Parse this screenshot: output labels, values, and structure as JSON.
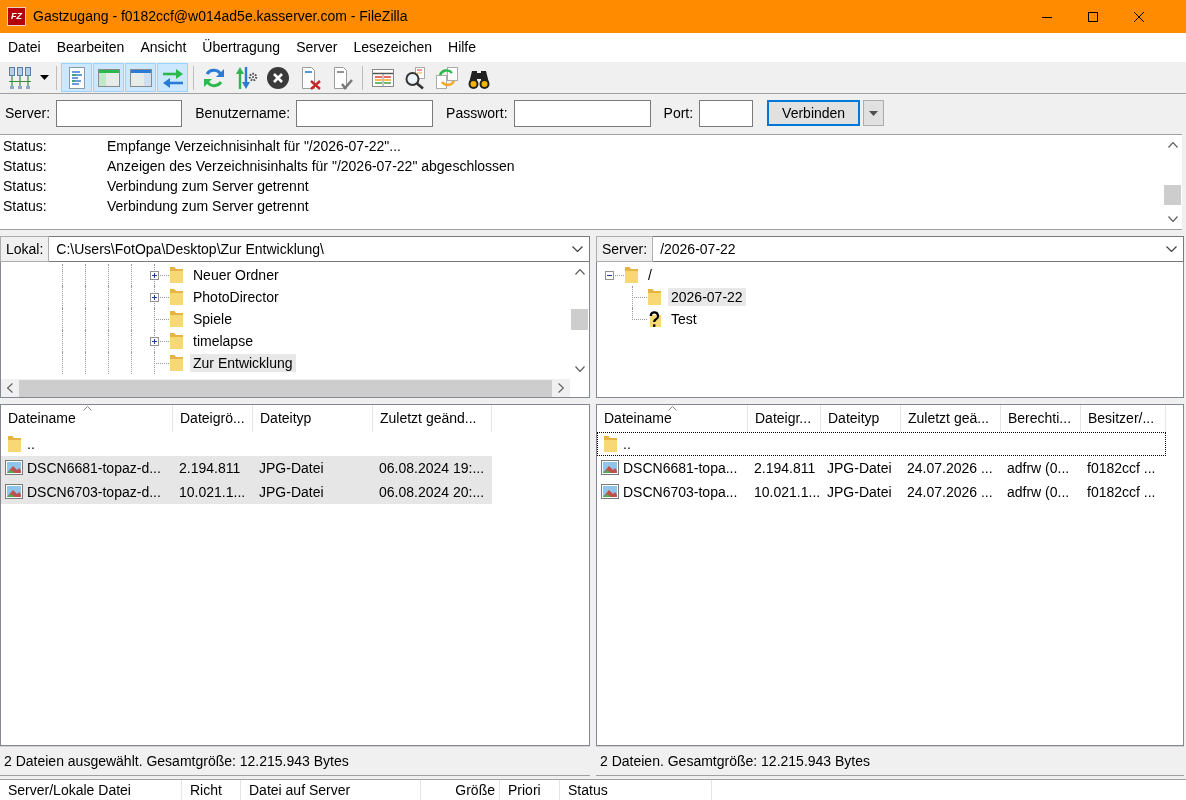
{
  "window": {
    "logo": "FZ",
    "title": "Gastzugang - f0182ccf@w014ad5e.kasserver.com - FileZilla"
  },
  "menu": [
    "Datei",
    "Bearbeiten",
    "Ansicht",
    "Übertragung",
    "Server",
    "Lesezeichen",
    "Hilfe"
  ],
  "toolbar": {
    "items": [
      {
        "kind": "button",
        "pressed": false
      },
      {
        "kind": "dropdown"
      },
      {
        "kind": "separator"
      },
      {
        "kind": "button",
        "pressed": true
      },
      {
        "kind": "button",
        "pressed": true
      },
      {
        "kind": "button",
        "pressed": true
      },
      {
        "kind": "button",
        "pressed": true
      },
      {
        "kind": "separator"
      },
      {
        "kind": "button",
        "pressed": false
      },
      {
        "kind": "button",
        "pressed": false
      },
      {
        "kind": "button",
        "pressed": false
      },
      {
        "kind": "button",
        "pressed": false
      },
      {
        "kind": "button",
        "pressed": false
      },
      {
        "kind": "separator"
      },
      {
        "kind": "button",
        "pressed": false
      },
      {
        "kind": "button",
        "pressed": false
      },
      {
        "kind": "button",
        "pressed": false
      },
      {
        "kind": "button",
        "pressed": false
      }
    ]
  },
  "quickconnect": {
    "fields": [
      {
        "label": "Server:"
      },
      {
        "label": "Benutzername:"
      },
      {
        "label": "Passwort:"
      },
      {
        "label": "Port:"
      }
    ],
    "connect_button": {
      "label": "Verbinden",
      "focused": true
    }
  },
  "message_log": {
    "lines": [
      {
        "type": "Status:",
        "message": "Empfange Verzeichnisinhalt für \"/2026-07-22\"..."
      },
      {
        "type": "Status:",
        "message": "Anzeigen des Verzeichnisinhalts für \"/2026-07-22\" abgeschlossen"
      },
      {
        "type": "Status:",
        "message": "Verbindung zum Server getrennt"
      },
      {
        "type": "Status:",
        "message": "Verbindung zum Server getrennt"
      }
    ]
  },
  "local": {
    "path_label": "Lokal:",
    "path": "C:\\Users\\FotOpa\\Desktop\\Zur Entwicklung\\",
    "tree": [
      {
        "label": "Neuer Ordner",
        "expanded": false,
        "selected": false
      },
      {
        "label": "PhotoDirector",
        "expanded": false,
        "selected": false
      },
      {
        "label": "Spiele",
        "selected": false
      },
      {
        "label": "timelapse",
        "expanded": false,
        "selected": false
      },
      {
        "label": "Zur Entwicklung",
        "selected": true
      }
    ],
    "files": {
      "columns": [
        {
          "label": "Dateiname",
          "sorted": true
        },
        {
          "label": "Dateigrö...",
          "sorted": false
        },
        {
          "label": "Dateityp",
          "sorted": false
        },
        {
          "label": "Zuletzt geänd...",
          "sorted": false
        }
      ],
      "rows": [
        {
          "kind": "folder",
          "selected": false,
          "cells": [
            ".."
          ]
        },
        {
          "kind": "image",
          "selected": true,
          "cells": [
            "DSCN6681-topaz-d...",
            "2.194.811",
            "JPG-Datei",
            "06.08.2024 19:..."
          ]
        },
        {
          "kind": "image",
          "selected": true,
          "cells": [
            "DSCN6703-topaz-d...",
            "10.021.1...",
            "JPG-Datei",
            "06.08.2024 20:..."
          ]
        }
      ]
    },
    "status": "2 Dateien ausgewählt. Gesamtgröße: 12.215.943 Bytes"
  },
  "remote": {
    "path_label": "Server:",
    "path": "/2026-07-22",
    "tree": [
      {
        "label": "/",
        "expanded": true,
        "selected": false,
        "children": [
          {
            "label": "2026-07-22",
            "kind": "folder",
            "selected": true
          },
          {
            "label": "Test",
            "kind": "unknown",
            "selected": false
          }
        ]
      }
    ],
    "files": {
      "columns": [
        {
          "label": "Dateiname",
          "sorted": true
        },
        {
          "label": "Dateigr...",
          "sorted": false
        },
        {
          "label": "Dateityp",
          "sorted": false
        },
        {
          "label": "Zuletzt geä...",
          "sorted": false
        },
        {
          "label": "Berechti...",
          "sorted": false
        },
        {
          "label": "Besitzer/...",
          "sorted": false
        }
      ],
      "rows": [
        {
          "kind": "folder",
          "selected": false,
          "focused": true,
          "cells": [
            ".."
          ]
        },
        {
          "kind": "image",
          "selected": false,
          "focused": false,
          "cells": [
            "DSCN6681-topa...",
            "2.194.811",
            "JPG-Datei",
            "24.07.2026 ...",
            "adfrw (0...",
            "f0182ccf ..."
          ]
        },
        {
          "kind": "image",
          "selected": false,
          "focused": false,
          "cells": [
            "DSCN6703-topa...",
            "10.021.1...",
            "JPG-Datei",
            "24.07.2026 ...",
            "adfrw (0...",
            "f0182ccf ..."
          ]
        }
      ]
    },
    "status": "2 Dateien. Gesamtgröße: 12.215.943 Bytes"
  },
  "queue": {
    "columns": [
      "Server/Lokale Datei",
      "Richt",
      "Datei auf Server",
      "Größe",
      "Priori",
      "Status"
    ]
  }
}
